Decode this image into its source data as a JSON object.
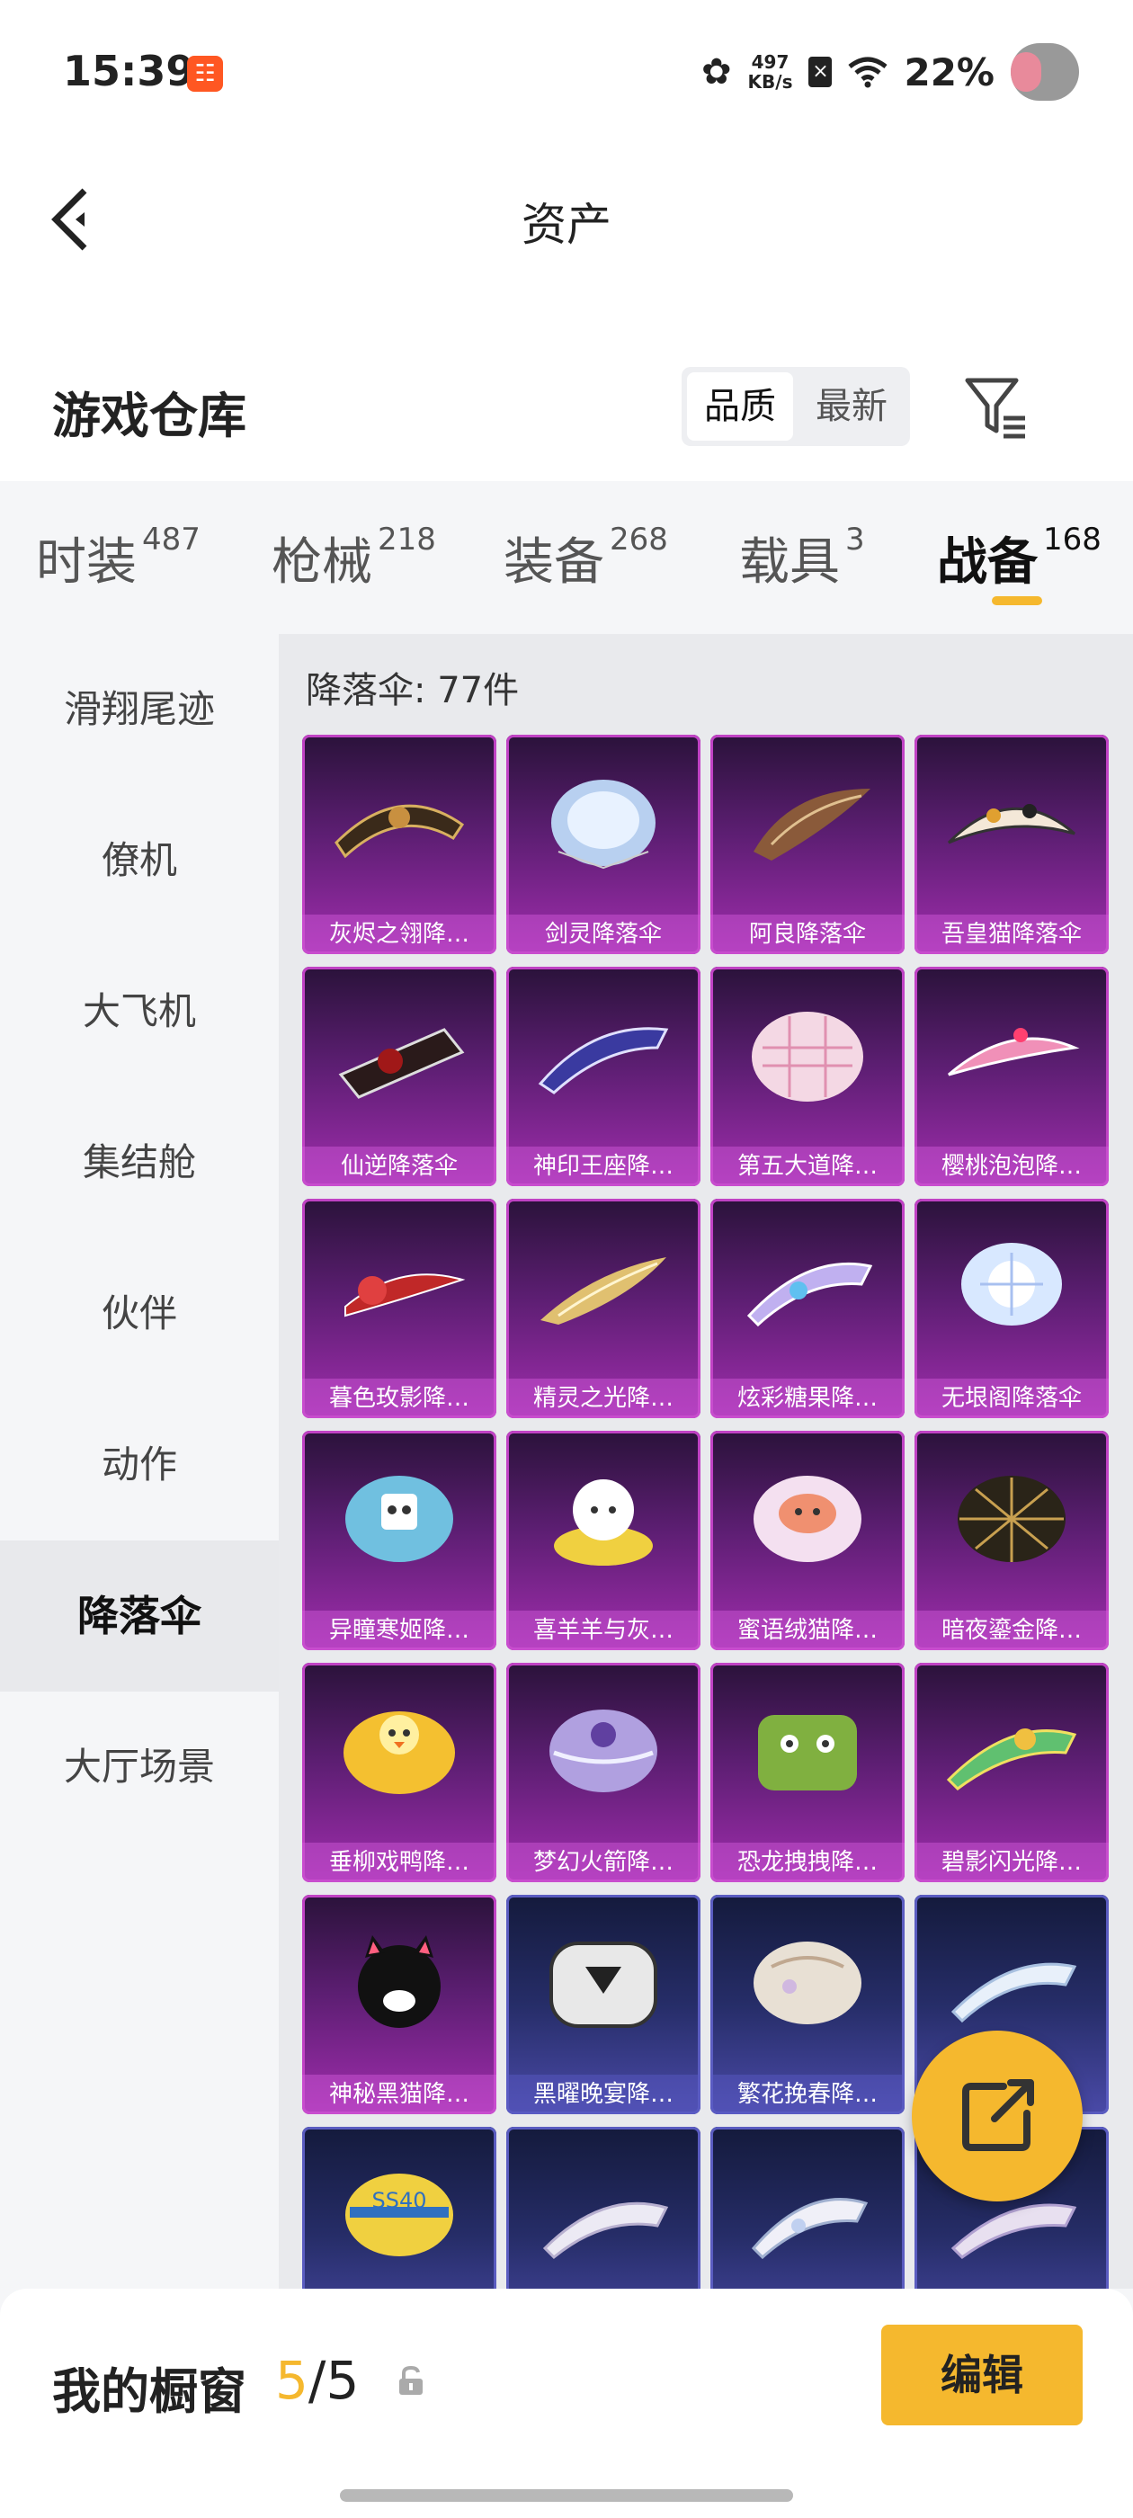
{
  "status_bar": {
    "time": "15:39",
    "speed_value": "497",
    "speed_unit": "KB/s",
    "battery": "22%",
    "icons": [
      "app-notification-icon",
      "flower-icon",
      "no-sim-icon",
      "wifi-icon",
      "avatar"
    ]
  },
  "header": {
    "title": "资产",
    "back_icon": "chevron-left-icon"
  },
  "warehouse": {
    "title": "游戏仓库",
    "sort_options": [
      "品质",
      "最新"
    ],
    "sort_selected": "品质",
    "filter_icon": "filter-icon"
  },
  "tabs": [
    {
      "label": "时装",
      "count": "487"
    },
    {
      "label": "枪械",
      "count": "218"
    },
    {
      "label": "装备",
      "count": "268"
    },
    {
      "label": "载具",
      "count": "3"
    },
    {
      "label": "战备",
      "count": "168"
    }
  ],
  "active_tab": "战备",
  "sidebar": {
    "items": [
      "滑翔尾迹",
      "僚机",
      "大飞机",
      "集结舱",
      "伙伴",
      "动作",
      "降落伞",
      "大厅场景"
    ],
    "active": "降落伞"
  },
  "content": {
    "title": "降落伞: 77件",
    "items": [
      {
        "label": "灰烬之翎降…",
        "quality": "purple"
      },
      {
        "label": "剑灵降落伞",
        "quality": "purple"
      },
      {
        "label": "阿良降落伞",
        "quality": "purple"
      },
      {
        "label": "吾皇猫降落伞",
        "quality": "purple"
      },
      {
        "label": "仙逆降落伞",
        "quality": "purple"
      },
      {
        "label": "神印王座降…",
        "quality": "purple"
      },
      {
        "label": "第五大道降…",
        "quality": "purple"
      },
      {
        "label": "樱桃泡泡降…",
        "quality": "purple"
      },
      {
        "label": "暮色玫影降…",
        "quality": "purple"
      },
      {
        "label": "精灵之光降…",
        "quality": "purple"
      },
      {
        "label": "炫彩糖果降…",
        "quality": "purple"
      },
      {
        "label": "无垠阁降落伞",
        "quality": "purple"
      },
      {
        "label": "异瞳寒姬降…",
        "quality": "purple"
      },
      {
        "label": "喜羊羊与灰…",
        "quality": "purple"
      },
      {
        "label": "蜜语绒猫降…",
        "quality": "purple"
      },
      {
        "label": "暗夜鎏金降…",
        "quality": "purple"
      },
      {
        "label": "垂柳戏鸭降…",
        "quality": "purple"
      },
      {
        "label": "梦幻火箭降…",
        "quality": "purple"
      },
      {
        "label": "恐龙拽拽降…",
        "quality": "purple"
      },
      {
        "label": "碧影闪光降…",
        "quality": "purple"
      },
      {
        "label": "神秘黑猫降…",
        "quality": "purple"
      },
      {
        "label": "黑曜晚宴降…",
        "quality": "blue"
      },
      {
        "label": "繁花挽春降…",
        "quality": "blue"
      },
      {
        "label": "",
        "quality": "blue"
      },
      {
        "label": "",
        "quality": "blue"
      },
      {
        "label": "",
        "quality": "blue"
      },
      {
        "label": "",
        "quality": "blue"
      },
      {
        "label": "",
        "quality": "blue"
      }
    ]
  },
  "fab": {
    "icon": "share-icon"
  },
  "showcase": {
    "label": "我的橱窗",
    "current": "5",
    "total": "/5",
    "lock_icon": "lock-icon",
    "edit_label": "编辑"
  },
  "colors": {
    "accent": "#f5b82e",
    "purple_quality": "#a02dad",
    "blue_quality": "#4a4aa8"
  }
}
